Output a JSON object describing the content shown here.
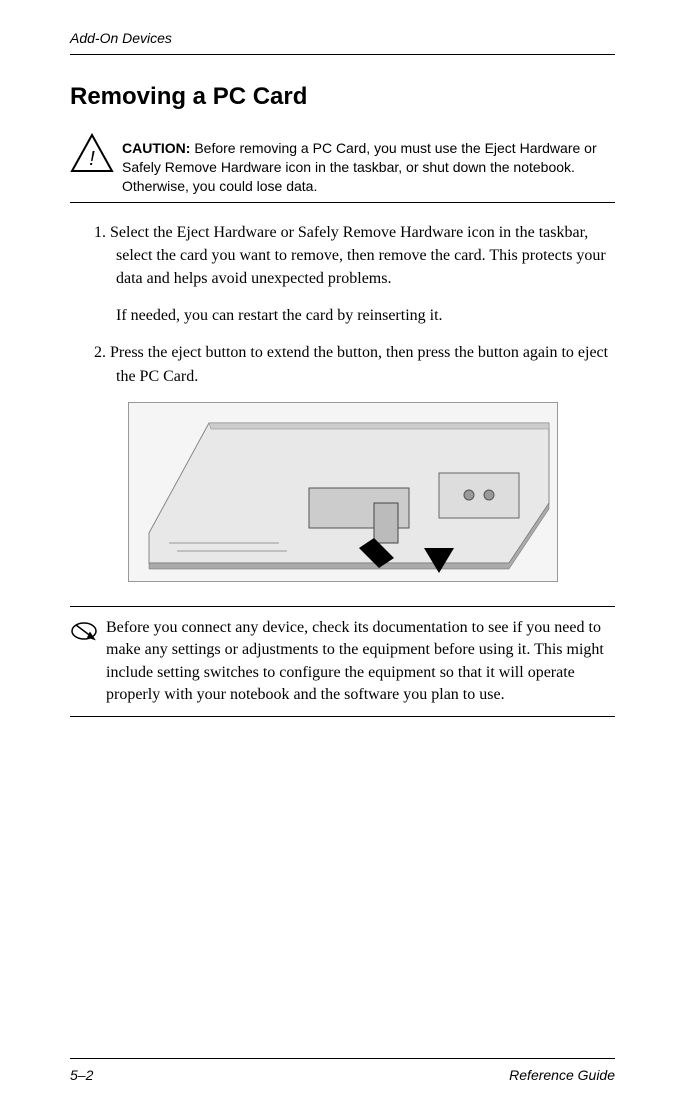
{
  "header": {
    "section_label": "Add-On Devices"
  },
  "title": "Removing a PC Card",
  "caution": {
    "label": "CAUTION:",
    "text": "Before removing a PC Card, you must use the Eject Hardware or Safely Remove Hardware icon in the taskbar, or shut down the notebook. Otherwise, you could lose data."
  },
  "steps": {
    "item1": "1. Select the Eject Hardware or Safely Remove Hardware icon in the taskbar, select the card you want to remove, then remove the card. This protects your data and helps avoid unexpected problems.",
    "item1_note": "If needed, you can restart the card by reinserting it.",
    "item2": "2. Press the eject button to extend the button, then press the button again to eject the PC Card."
  },
  "note": {
    "text": "Before you connect any device, check its documentation to see if you need to make any settings or adjustments to the equipment before using it. This might include setting switches to configure the equipment so that it will operate properly with your notebook and the software you plan to use."
  },
  "footer": {
    "page": "5–2",
    "doc": "Reference Guide"
  }
}
